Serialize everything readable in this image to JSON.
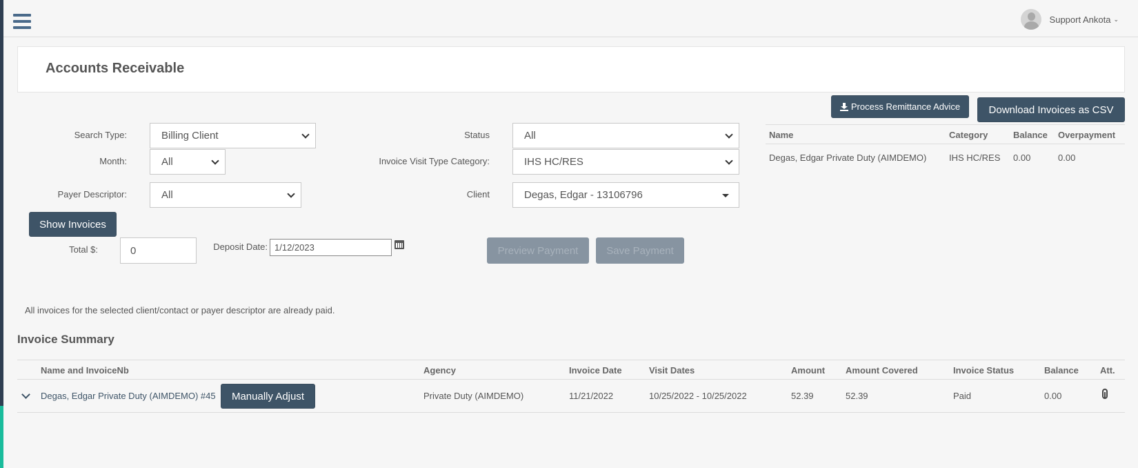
{
  "header": {
    "user_name": "Support Ankota",
    "page_title": "Accounts Receivable"
  },
  "actions": {
    "process_remittance": "Process Remittance Advice",
    "download_csv": "Download Invoices as CSV",
    "show_invoices": "Show Invoices",
    "preview_payment": "Preview Payment",
    "save_payment": "Save Payment",
    "manually_adjust": "Manually Adjust"
  },
  "filters": {
    "search_type_label": "Search Type:",
    "search_type_value": "Billing Client",
    "month_label": "Month:",
    "month_value": "All",
    "payer_label": "Payer Descriptor:",
    "payer_value": "All",
    "status_label": "Status",
    "status_value": "All",
    "visit_type_label": "Invoice Visit Type Category:",
    "visit_type_value": "IHS HC/RES",
    "client_label": "Client",
    "client_value": "Degas, Edgar - 13106796"
  },
  "payment": {
    "total_label": "Total $:",
    "total_value": "0",
    "deposit_label": "Deposit Date:",
    "deposit_value": "1/12/2023"
  },
  "balance_table": {
    "headers": [
      "Name",
      "Category",
      "Balance",
      "Overpayment"
    ],
    "rows": [
      [
        "Degas, Edgar Private Duty (AIMDEMO)",
        "IHS HC/RES",
        "0.00",
        "0.00"
      ]
    ]
  },
  "notice": "All invoices for the selected client/contact or payer descriptor are already paid.",
  "invoice_summary": {
    "title": "Invoice Summary",
    "headers": [
      "Name and InvoiceNb",
      "Agency",
      "Invoice Date",
      "Visit Dates",
      "Amount",
      "Amount Covered",
      "Invoice Status",
      "Balance",
      "Att."
    ],
    "rows": [
      [
        "Degas, Edgar Private Duty (AIMDEMO) #45",
        "Private Duty (AIMDEMO)",
        "11/21/2022",
        "10/25/2022 - 10/25/2022",
        "52.39",
        "52.39",
        "Paid",
        "0.00"
      ]
    ]
  },
  "icons": {
    "menu": "hamburger-icon",
    "avatar": "user-avatar-icon",
    "calendar": "calendar-icon",
    "attachment": "paperclip-icon",
    "expand": "chevron-down-icon",
    "download": "download-icon"
  },
  "colors": {
    "primary_button": "#3e5467",
    "disabled_button": "#8794a1",
    "sidebar": "#2f3f52",
    "sidebar_accent": "#1abc9c"
  }
}
